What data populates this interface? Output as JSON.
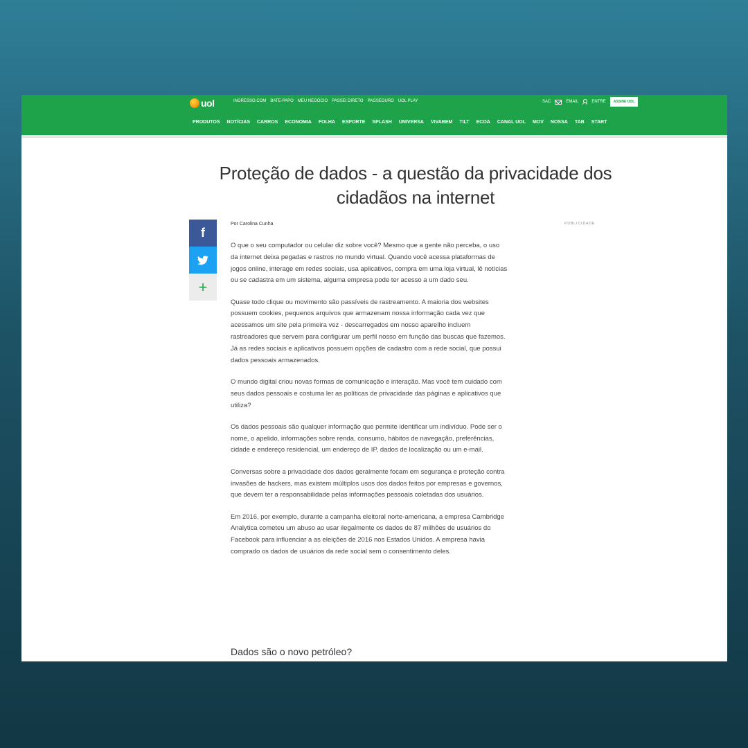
{
  "brand": {
    "logo_text": "uol"
  },
  "topbar": {
    "links": [
      "INGRESSO.COM",
      "BATE-PAPO",
      "MEU NEGÓCIO",
      "PASSEI DIRETO",
      "PAGSEGURO",
      "UOL PLAY"
    ],
    "sac": "SAC",
    "email": "EMAIL",
    "entre": "ENTRE",
    "assine": "ASSINE UOL"
  },
  "nav": {
    "items": [
      "PRODUTOS",
      "NOTÍCIAS",
      "CARROS",
      "ECONOMIA",
      "FOLHA",
      "ESPORTE",
      "SPLASH",
      "UNIVERSA",
      "VIVABEM",
      "TILT",
      "ECOA",
      "CANAL UOL",
      "MOV",
      "NOSSA",
      "TAB",
      "START"
    ]
  },
  "article": {
    "title": "Proteção de dados - a questão da privacidade dos cidadãos na internet",
    "byline": "Por Carolina Cunha",
    "ad_label": "PUBLICIDADE",
    "paragraphs": [
      "O que o seu computador ou celular diz sobre você? Mesmo que a gente não perceba, o uso da internet deixa pegadas e rastros no mundo virtual. Quando você acessa plataformas de jogos online, interage em redes sociais, usa aplicativos, compra em uma loja virtual, lê notícias ou se cadastra em um sistema, alguma empresa pode ter acesso a um dado seu.",
      "Quase todo clique ou movimento são passíveis de rastreamento. A maioria dos websites possuem cookies, pequenos arquivos que armazenam nossa informação cada vez que acessamos um site pela primeira vez - descarregados em nosso aparelho incluem rastreadores que servem para configurar um perfil nosso em função das buscas que fazemos. Já as redes sociais e aplicativos possuem opções de cadastro com a rede social, que possui dados pessoais armazenados.",
      "O mundo digital criou novas formas de comunicação e interação. Mas você tem cuidado com seus dados pessoais e costuma ler as políticas de privacidade das páginas e aplicativos que utiliza?",
      "Os dados pessoais são qualquer informação que permite identificar um indivíduo. Pode ser o nome, o apelido, informações sobre renda, consumo, hábitos de navegação, preferências, cidade e endereço residencial, um endereço de IP, dados de localização ou um e-mail.",
      "Conversas sobre a privacidade dos dados geralmente focam em segurança e proteção contra invasões de hackers, mas existem múltiplos usos dos dados feitos por empresas e governos, que devem ter a responsabilidade pelas informações pessoais coletadas dos usuários.",
      "Em 2016, por exemplo, durante a campanha eleitoral norte-americana, a empresa Cambridge Analytica cometeu um abuso ao usar ilegalmente os dados de 87 milhões de usuários do Facebook para influenciar a as eleições de 2016 nos Estados Unidos. A empresa havia comprado os dados de usuários da rede social sem o consentimento deles."
    ],
    "subheading": "Dados são o novo petróleo?"
  },
  "share": {
    "facebook": "f",
    "more": "+"
  },
  "colors": {
    "brand_green": "#1fa34a",
    "facebook": "#3b5998",
    "twitter": "#1da1f2"
  }
}
